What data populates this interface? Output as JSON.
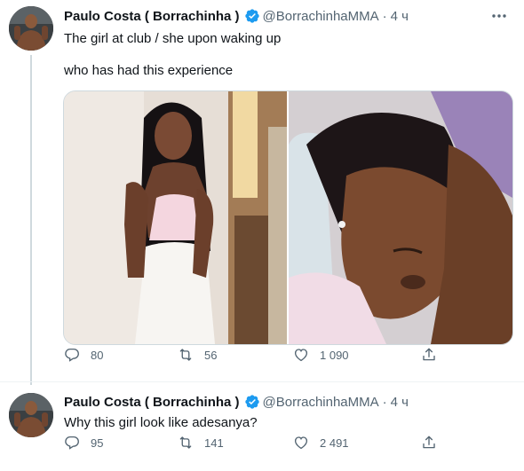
{
  "colors": {
    "text": "#0f1419",
    "secondary": "#536471",
    "verified": "#1d9bf0",
    "divider": "#eff3f4"
  },
  "tweets": [
    {
      "author_name": "Paulo Costa ( Borrachinha )",
      "handle": "@BorrachinhaMMA",
      "separator": "·",
      "time": "4 ч",
      "text_line_1": "The girl at club / she upon waking up",
      "text_line_2": "who has had this experience",
      "media_count": 2,
      "replies": "80",
      "retweets": "56",
      "likes": "1 090",
      "verified": true,
      "icons": [
        "more-icon",
        "reply-icon",
        "retweet-icon",
        "like-icon",
        "share-icon",
        "verified-badge-icon"
      ]
    },
    {
      "author_name": "Paulo Costa ( Borrachinha )",
      "handle": "@BorrachinhaMMA",
      "separator": "·",
      "time": "4 ч",
      "text_line_1": "Why this girl look like adesanya?",
      "replies": "95",
      "retweets": "141",
      "likes": "2 491",
      "verified": true,
      "icons": [
        "reply-icon",
        "retweet-icon",
        "like-icon",
        "share-icon",
        "verified-badge-icon"
      ]
    }
  ]
}
